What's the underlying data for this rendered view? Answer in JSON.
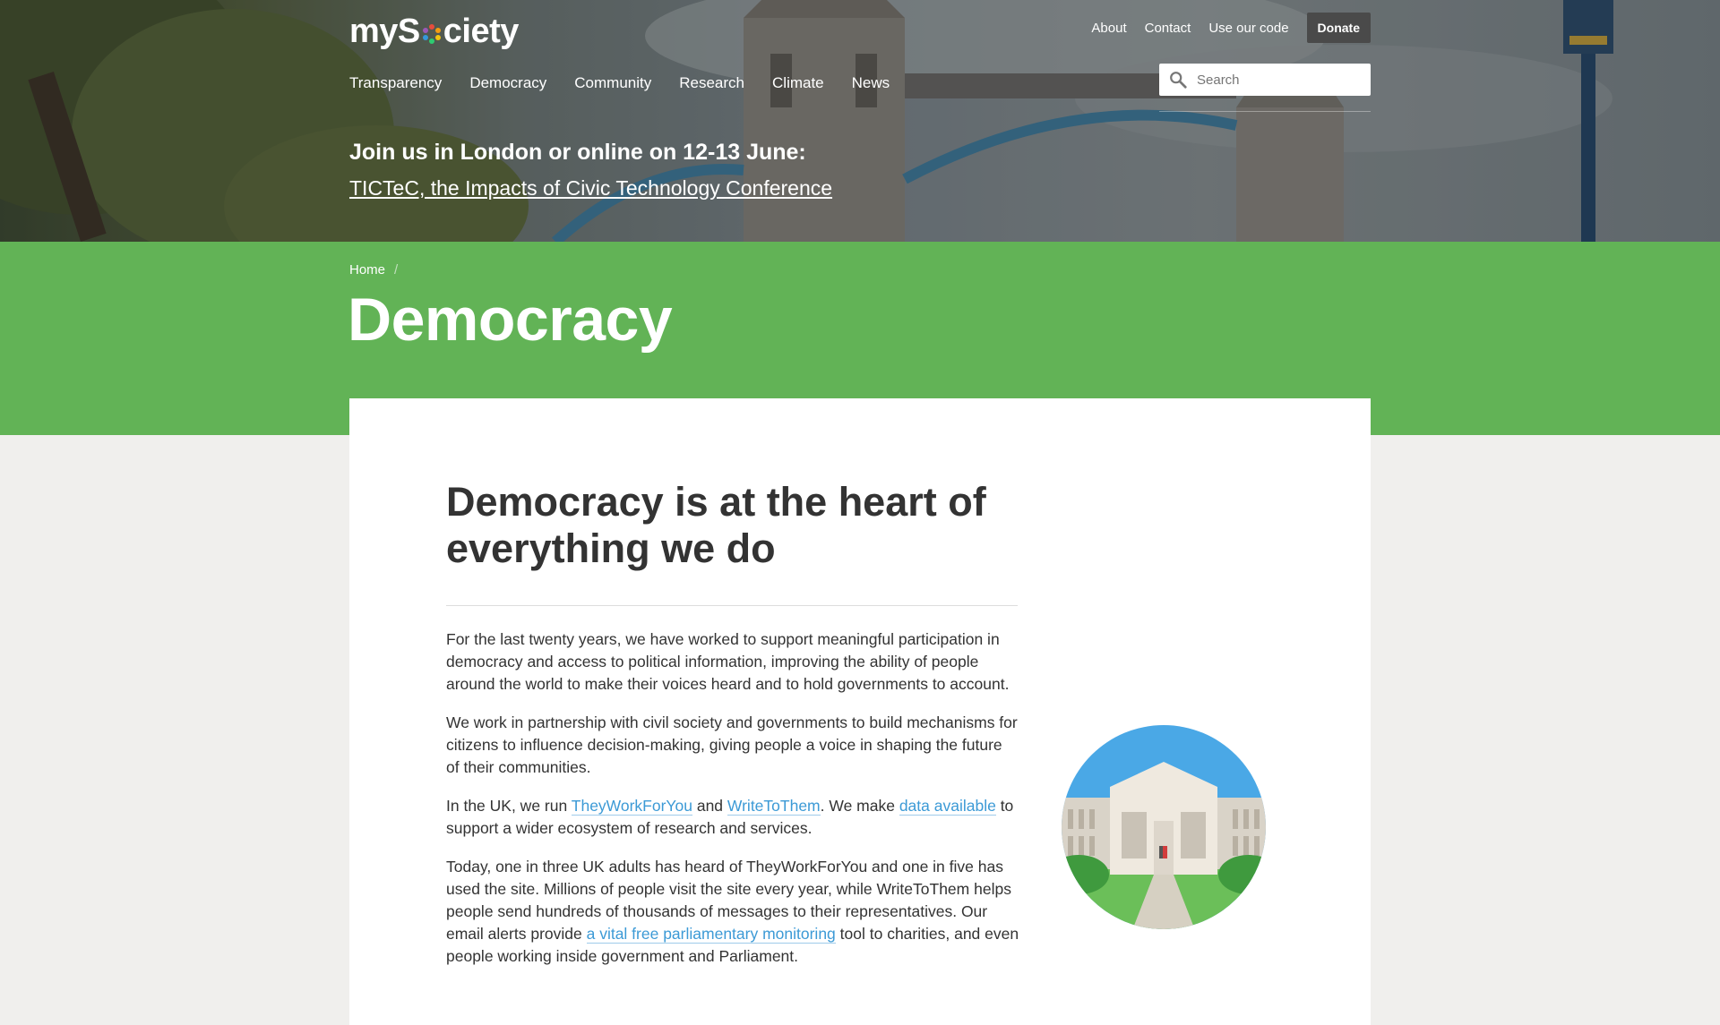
{
  "site": {
    "logo_text_before": "myS",
    "logo_text_after": "ciety",
    "utility_nav": [
      "About",
      "Contact",
      "Use our code"
    ],
    "donate_label": "Donate",
    "main_nav": [
      "Transparency",
      "Democracy",
      "Community",
      "Research",
      "Climate",
      "News"
    ],
    "search_placeholder": "Search"
  },
  "banner": {
    "title": "Join us in London or online on 12-13 June:",
    "link_text": "TICTeC, the Impacts of Civic Technology Conference"
  },
  "breadcrumb": {
    "home": "Home",
    "separator": "/"
  },
  "page": {
    "title": "Democracy"
  },
  "content": {
    "heading": "Democracy is at the heart of everything we do",
    "p1": "For the last twenty years, we have worked to support meaningful participation in democracy and access to political information, improving the ability of people around the world to make their voices heard and to hold governments to account.",
    "p2": "We work in partnership with civil society and governments to build mechanisms for citizens to influence decision-making, giving people a voice in shaping the future of their communities.",
    "p3_a": "In the UK, we run ",
    "p3_link1": "TheyWorkForYou",
    "p3_b": " and ",
    "p3_link2": "WriteToThem",
    "p3_c": ". We make ",
    "p3_link3": "data available",
    "p3_d": " to support a wider ecosystem of research and services.",
    "p4_a": "Today, one in three UK adults has heard of TheyWorkForYou and one in five has used the site. Millions of people visit the site every year, while WriteToThem helps people send hundreds of thousands of messages to their representatives. Our email alerts provide ",
    "p4_link": "a vital free parliamentary monitoring",
    "p4_b": " tool to charities, and even people working inside government and Parliament."
  },
  "colors": {
    "green_band": "#62b356",
    "link": "#3c9ad6",
    "donate_bg": "#4a4a4a",
    "page_bg": "#f0efed"
  },
  "icons": [
    "search-icon",
    "logo-ring-icon",
    "parliament-building-illustration"
  ]
}
